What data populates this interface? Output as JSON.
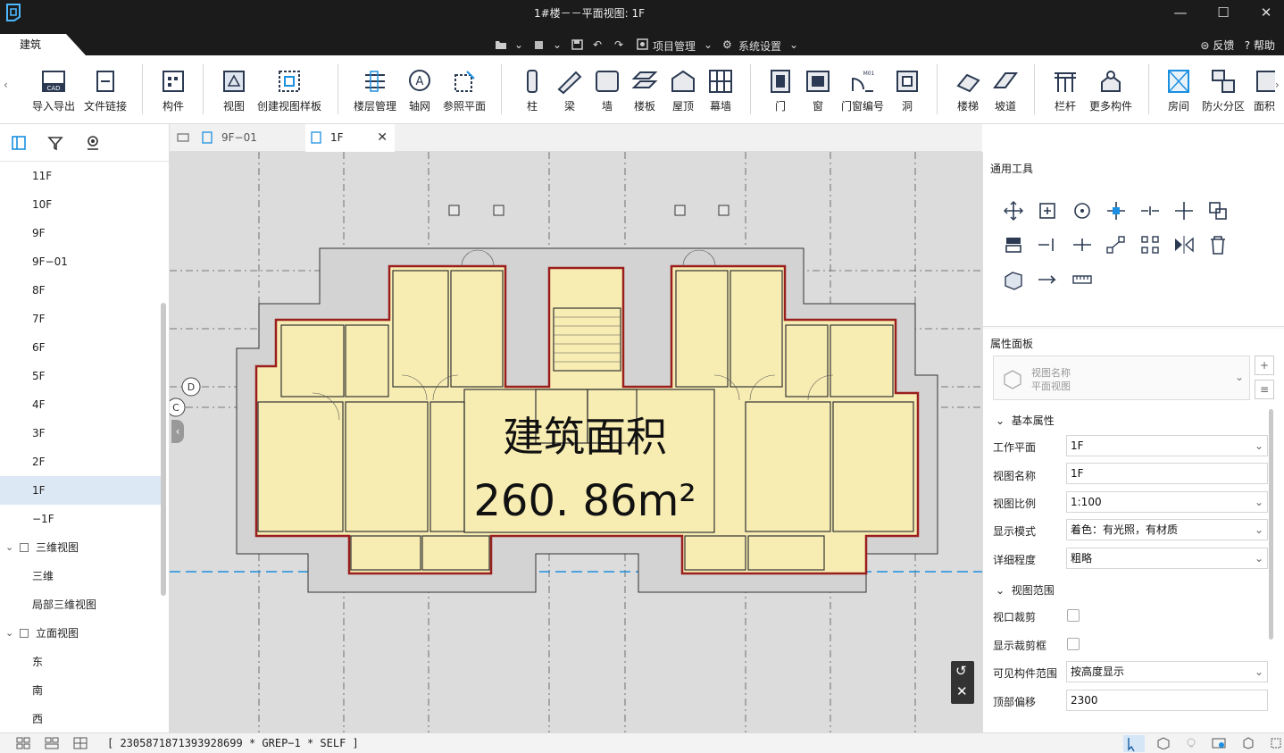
{
  "window": {
    "title": "1#楼－－平面视图: 1F",
    "minimize": "—",
    "maximize": "☐",
    "close": "✕"
  },
  "menubar": {
    "tab": "建筑",
    "project": "项目管理",
    "settings": "系统设置",
    "feedback": "反馈",
    "help": "帮助"
  },
  "ribbon": {
    "items": [
      "导入导出",
      "文件链接",
      "构件",
      "视图",
      "创建视图样板",
      "楼层管理",
      "轴网",
      "参照平面",
      "柱",
      "梁",
      "墙",
      "楼板",
      "屋顶",
      "幕墙",
      "门",
      "窗",
      "门窗编号",
      "洞",
      "楼梯",
      "坡道",
      "栏杆",
      "更多构件",
      "房间",
      "防火分区",
      "面积"
    ],
    "cad_badge": "CAD"
  },
  "sidebar": {
    "tree": [
      "11F",
      "10F",
      "9F",
      "9F−01",
      "8F",
      "7F",
      "6F",
      "5F",
      "4F",
      "3F",
      "2F",
      "1F",
      "−1F",
      "三维视图",
      "三维",
      "局部三维视图",
      "立面视图",
      "东",
      "南",
      "西"
    ],
    "selected": "1F"
  },
  "doctabs": [
    {
      "label": "9F−01"
    },
    {
      "label": "1F"
    }
  ],
  "canvas": {
    "area_title": "建筑面积",
    "area_value": "260. 86m²",
    "axis_d": "D",
    "axis_c": "C"
  },
  "rpanel": {
    "tools_title": "通用工具",
    "props_title": "属性面板",
    "view_name_label": "视图名称",
    "view_name_value": "平面视图",
    "sec_basic": "基本属性",
    "sec_range": "视图范围",
    "fields": [
      {
        "label": "工作平面",
        "value": "1F"
      },
      {
        "label": "视图名称",
        "value": "1F"
      },
      {
        "label": "视图比例",
        "value": "1:100"
      },
      {
        "label": "显示模式",
        "value": "着色：有光照，有材质"
      },
      {
        "label": "详细程度",
        "value": "粗略"
      },
      {
        "label": "视口裁剪",
        "value": ""
      },
      {
        "label": "显示裁剪框",
        "value": ""
      },
      {
        "label": "可见构件范围",
        "value": "按高度显示"
      },
      {
        "label": "顶部偏移",
        "value": "2300"
      }
    ]
  },
  "status": {
    "text": "[ 2305871871393928699 * GREP−1 * SELF ]"
  }
}
